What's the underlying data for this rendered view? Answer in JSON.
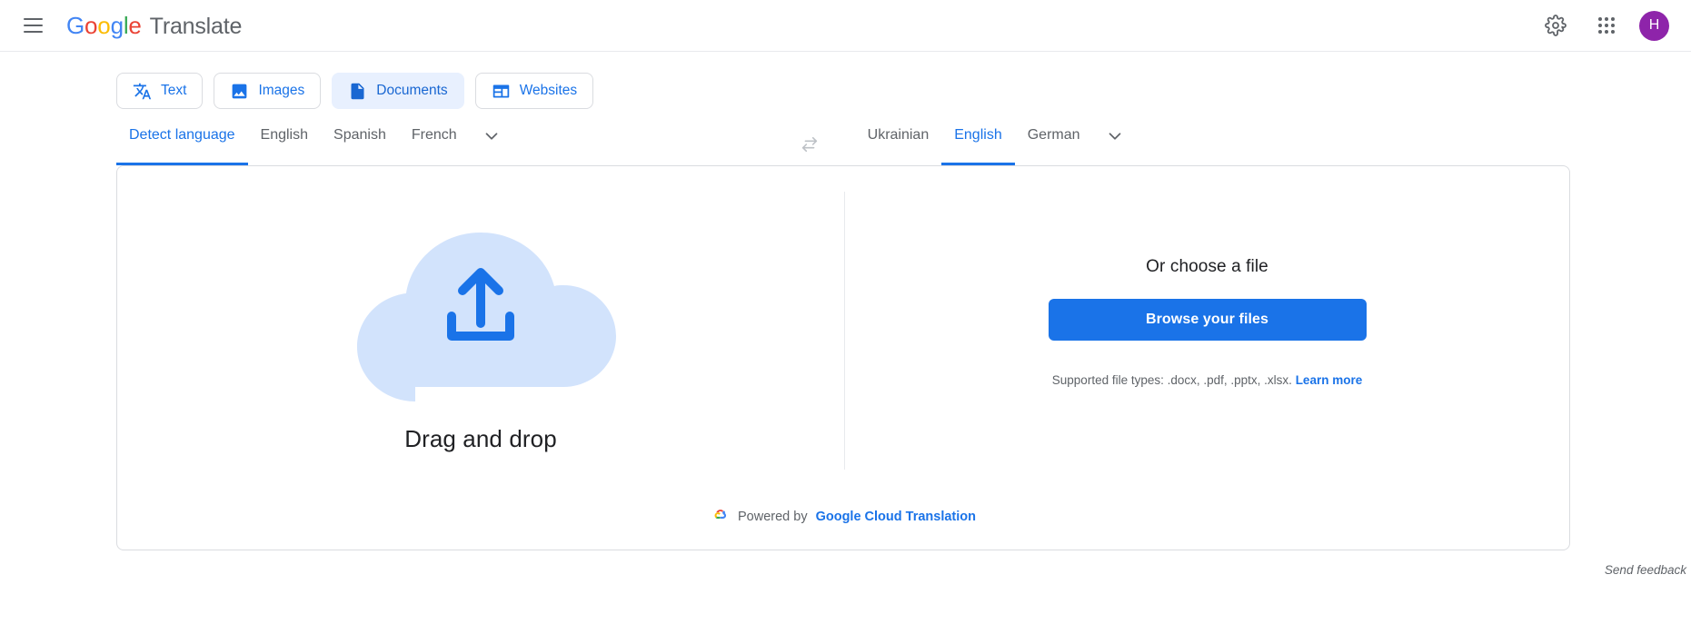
{
  "header": {
    "menu_icon": "hamburger-menu-icon",
    "brand": {
      "google": "Google",
      "product": "Translate"
    },
    "settings_icon": "gear-icon",
    "apps_icon": "apps-grid-icon",
    "avatar_initial": "H"
  },
  "mode_tabs": [
    {
      "label": "Text",
      "icon": "translate-icon",
      "active": false
    },
    {
      "label": "Images",
      "icon": "image-icon",
      "active": false
    },
    {
      "label": "Documents",
      "icon": "document-icon",
      "active": true
    },
    {
      "label": "Websites",
      "icon": "website-icon",
      "active": false
    }
  ],
  "source_languages": [
    {
      "label": "Detect language",
      "selected": true
    },
    {
      "label": "English",
      "selected": false
    },
    {
      "label": "Spanish",
      "selected": false
    },
    {
      "label": "French",
      "selected": false
    }
  ],
  "target_languages": [
    {
      "label": "Ukrainian",
      "selected": false
    },
    {
      "label": "English",
      "selected": true
    },
    {
      "label": "German",
      "selected": false
    }
  ],
  "swap_icon": "swap-languages-icon",
  "more_languages_icon": "chevron-down-icon",
  "dropzone": {
    "upload_icon": "cloud-upload-icon",
    "label": "Drag and drop"
  },
  "chooser": {
    "title": "Or choose a file",
    "browse_label": "Browse your files",
    "supported_types": "Supported file types: .docx, .pdf, .pptx, .xlsx.",
    "learn_more": "Learn more"
  },
  "card_footer": {
    "logo_icon": "google-cloud-icon",
    "powered_by": "Powered by",
    "service": "Google Cloud Translation"
  },
  "feedback": {
    "label": "Send feedback"
  },
  "colors": {
    "accent_blue": "#1a73e8",
    "tab_active_bg": "#e8f0fe",
    "cloud_fill": "#d2e3fc",
    "avatar_bg": "#8e24aa",
    "text_primary": "#202124",
    "text_secondary": "#5f6368",
    "border": "#dadce0"
  }
}
